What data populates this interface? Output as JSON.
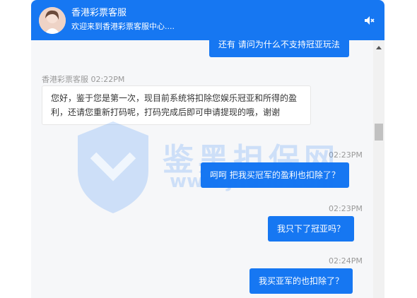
{
  "header": {
    "title": "香港彩票客服",
    "subtitle": "欢迎来到香港彩票客服中心....",
    "avatar_icon": "agent-avatar-icon",
    "mute_icon": "speaker-mute-icon"
  },
  "messages": {
    "m0": {
      "text": "还有 请问为什么不支持冠亚玩法"
    },
    "m1": {
      "sender": "香港彩票客服",
      "time": "02:22PM",
      "text": "您好，鉴于您是第一次，现目前系统将扣除您娱乐冠亚和所得的盈利，还请您重新打码呢，打码完成后即可申请提现的哦，谢谢"
    },
    "m2": {
      "time": "02:23PM",
      "text": "呵呵 把我买冠军的盈利也扣除了？"
    },
    "m3": {
      "time": "02:23PM",
      "text": "我只下了冠亚吗？"
    },
    "m4": {
      "time": "02:24PM",
      "text": "我买亚军的也扣除了？"
    }
  },
  "watermark": {
    "text": "鉴黑担保网",
    "url": "www.jhdb8.com"
  },
  "colors": {
    "accent": "#1677f2",
    "chat_bg": "#f6f7f9"
  }
}
